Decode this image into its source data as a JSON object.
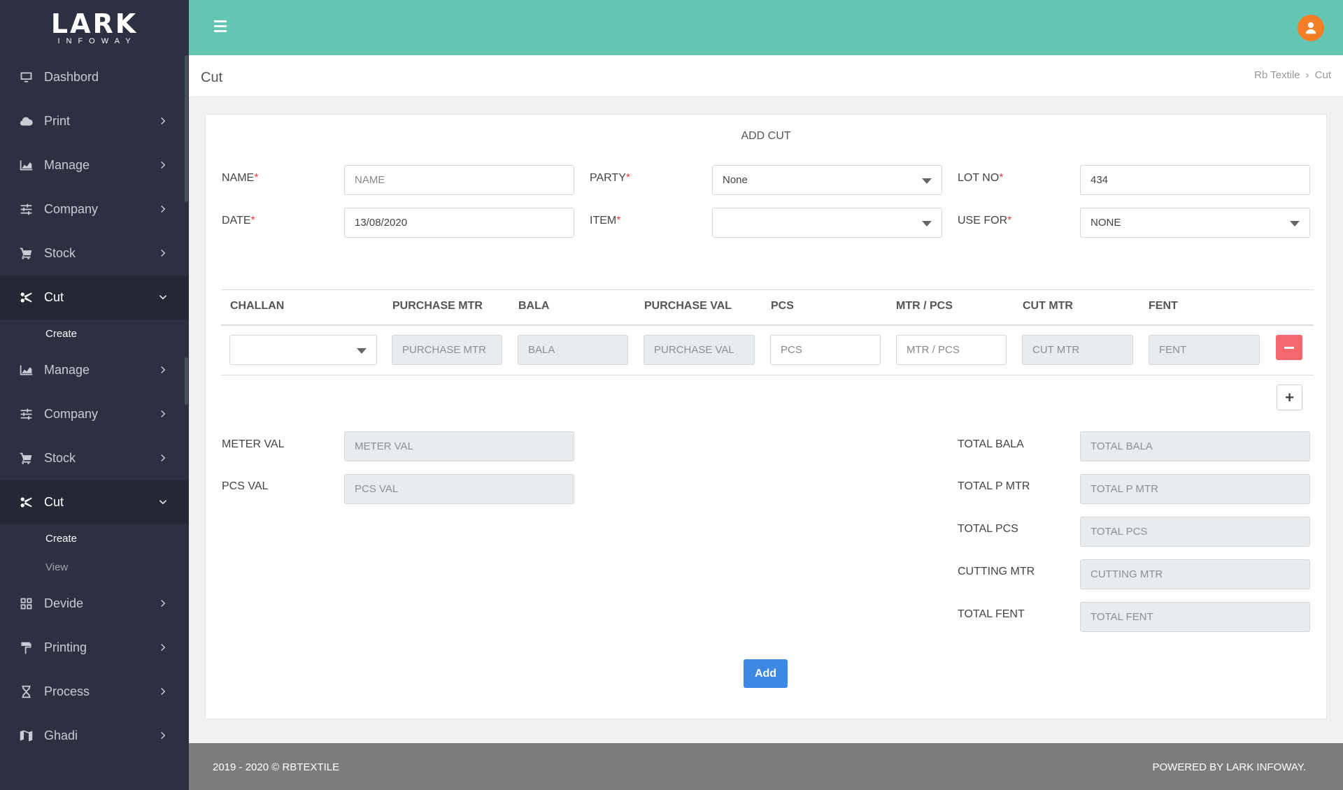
{
  "logo": {
    "title": "LARK",
    "subtitle": "INFOWAY"
  },
  "sidebar": {
    "items": [
      {
        "label": "Dashbord",
        "icon": "monitor-icon"
      },
      {
        "label": "Print",
        "icon": "cloud-icon"
      },
      {
        "label": "Manage",
        "icon": "chart-icon"
      },
      {
        "label": "Company",
        "icon": "sliders-icon"
      },
      {
        "label": "Stock",
        "icon": "cart-icon"
      },
      {
        "label": "Cut",
        "icon": "scissors-icon"
      },
      {
        "label": "Create"
      },
      {
        "label": "Manage",
        "icon": "chart-icon"
      },
      {
        "label": "Company",
        "icon": "sliders-icon"
      },
      {
        "label": "Stock",
        "icon": "cart-icon"
      },
      {
        "label": "Cut",
        "icon": "scissors-icon"
      },
      {
        "label": "Create"
      },
      {
        "label": "View"
      },
      {
        "label": "Devide",
        "icon": "grid-icon"
      },
      {
        "label": "Printing",
        "icon": "paint-roller-icon"
      },
      {
        "label": "Process",
        "icon": "hourglass-icon"
      },
      {
        "label": "Ghadi",
        "icon": "map-icon"
      }
    ]
  },
  "header": {
    "title": "Cut",
    "breadcrumb": [
      "Rb Textile",
      "Cut"
    ]
  },
  "form": {
    "title": "ADD CUT",
    "name": {
      "label": "NAME",
      "placeholder": "NAME",
      "value": ""
    },
    "party": {
      "label": "PARTY",
      "value": "None"
    },
    "lot_no": {
      "label": "LOT NO",
      "value": "434"
    },
    "date": {
      "label": "DATE",
      "value": "13/08/2020"
    },
    "item": {
      "label": "ITEM",
      "value": ""
    },
    "use_for": {
      "label": "USE FOR",
      "value": "NONE"
    },
    "required_mark": "*"
  },
  "table": {
    "columns": [
      "CHALLAN",
      "PURCHASE MTR",
      "BALA",
      "PURCHASE VAL",
      "PCS",
      "MTR / PCS",
      "CUT MTR",
      "FENT"
    ],
    "row": {
      "challan": "",
      "purchase_mtr": "PURCHASE MTR",
      "bala": "BALA",
      "purchase_val": "PURCHASE VAL",
      "pcs": "PCS",
      "mtr_pcs": "MTR / PCS",
      "cut_mtr": "CUT MTR",
      "fent": "FENT"
    },
    "add_row": "+"
  },
  "summary": {
    "meter_val": {
      "label": "METER VAL",
      "placeholder": "METER VAL"
    },
    "pcs_val": {
      "label": "PCS VAL",
      "placeholder": "PCS VAL"
    },
    "total_bala": {
      "label": "TOTAL BALA",
      "placeholder": "TOTAL BALA"
    },
    "total_p_mtr": {
      "label": "TOTAL P MTR",
      "placeholder": "TOTAL P MTR"
    },
    "total_pcs": {
      "label": "TOTAL PCS",
      "placeholder": "TOTAL PCS"
    },
    "cutting_mtr": {
      "label": "CUTTING MTR",
      "placeholder": "CUTTING MTR"
    },
    "total_fent": {
      "label": "TOTAL FENT",
      "placeholder": "TOTAL FENT"
    }
  },
  "actions": {
    "add_label": "Add"
  },
  "footer": {
    "left": "2019 - 2020 © RBTEXTILE",
    "right": "POWERED BY LARK INFOWAY."
  },
  "colors": {
    "topbar": "#63c6b2",
    "sidebar": "#2c3040",
    "primary": "#3c89e3",
    "danger": "#f4676c",
    "avatar": "#f37e25"
  }
}
